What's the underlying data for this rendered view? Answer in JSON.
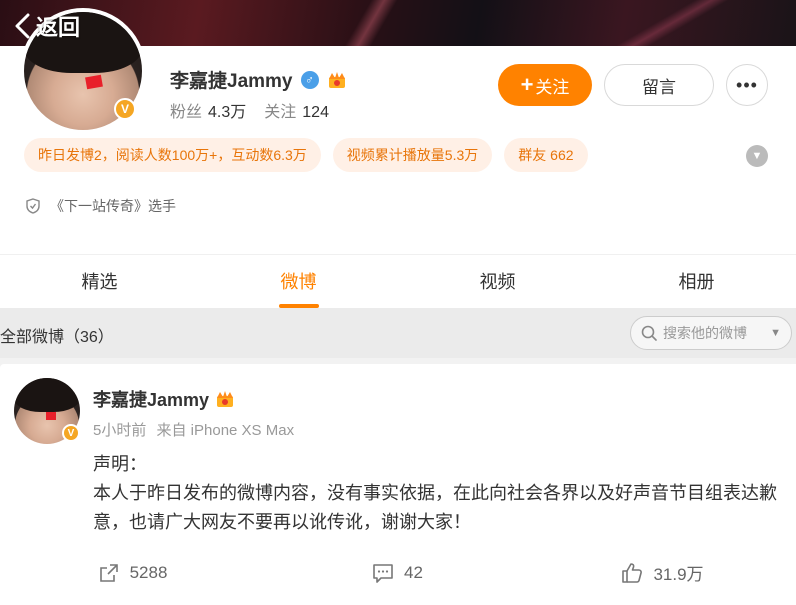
{
  "nav": {
    "back_label": "返回"
  },
  "profile": {
    "name": "李嘉捷Jammy",
    "gender_symbol": "♂",
    "verified_symbol": "V",
    "followers_label": "粉丝",
    "followers_value": "4.3万",
    "following_label": "关注",
    "following_value": "124",
    "follow_button": "关注",
    "follow_plus": "+",
    "message_button": "留言",
    "more_button": "•••",
    "tags": [
      "昨日发博2，阅读人数100万+，互动数6.3万",
      "视频累计播放量5.3万",
      "群友 662"
    ],
    "info": "《下一站传奇》选手"
  },
  "tabs": [
    {
      "label": "精选",
      "active": false
    },
    {
      "label": "微博",
      "active": true
    },
    {
      "label": "视频",
      "active": false
    },
    {
      "label": "相册",
      "active": false
    }
  ],
  "filter": {
    "label": "全部微博（36）",
    "search_placeholder": "搜索他的微博"
  },
  "post": {
    "author": "李嘉捷Jammy",
    "time": "5小时前",
    "source": "来自 iPhone XS Max",
    "body_line1": "声明：",
    "body_line2": "本人于昨日发布的微博内容，没有事实依据，在此向社会各界以及好声音节目组表达歉意，也请广大网友不要再以讹传讹，谢谢大家！",
    "reposts": "5288",
    "comments": "42",
    "likes": "31.9万"
  },
  "colors": {
    "accent": "#ff8200",
    "tag_bg": "#fff0e6",
    "tag_text": "#e8750a",
    "verified": "#f5a623",
    "gender": "#4a9fe8"
  }
}
